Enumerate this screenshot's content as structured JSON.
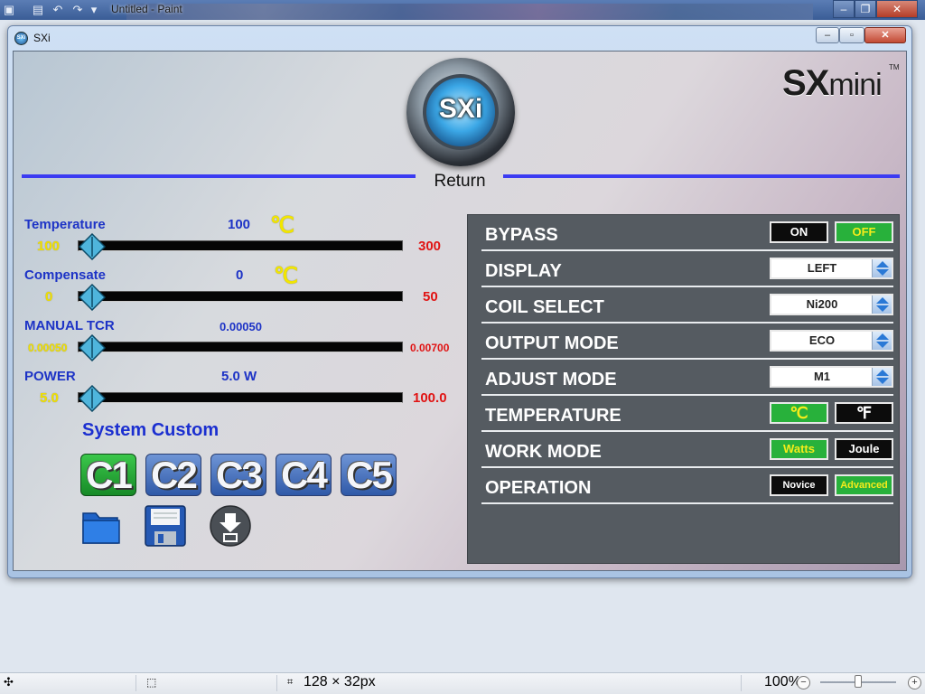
{
  "paint": {
    "title": "Untitled - Paint",
    "status": {
      "selection_size": "128 × 32px",
      "zoom": "100%"
    }
  },
  "window": {
    "title": "SXi"
  },
  "header": {
    "logo_text": "SXi",
    "brand_main": "SX",
    "brand_sub": "mini",
    "brand_tm": "TM",
    "return_label": "Return"
  },
  "sliders": [
    {
      "label": "Temperature",
      "value": "100",
      "unit": "℃",
      "min": "100",
      "max": "300"
    },
    {
      "label": "Compensate",
      "value": "0",
      "unit": "℃",
      "min": "0",
      "max": "50"
    },
    {
      "label": "MANUAL TCR",
      "value": "0.00050",
      "unit": "",
      "min": "0.00050",
      "max": "0.00700"
    },
    {
      "label": "POWER",
      "value": "5.0 W",
      "unit": "",
      "min": "5.0",
      "max": "100.0"
    }
  ],
  "system_custom": {
    "title": "System Custom",
    "buttons": [
      "C1",
      "C2",
      "C3",
      "C4",
      "C5"
    ],
    "active": "C1"
  },
  "settings": {
    "bypass": {
      "label": "BYPASS",
      "options": [
        "ON",
        "OFF"
      ],
      "selected": "OFF"
    },
    "display": {
      "label": "DISPLAY",
      "value": "LEFT"
    },
    "coil_select": {
      "label": "COIL SELECT",
      "value": "Ni200"
    },
    "output_mode": {
      "label": "OUTPUT MODE",
      "value": "ECO"
    },
    "adjust_mode": {
      "label": "ADJUST MODE",
      "value": "M1"
    },
    "temperature": {
      "label": "TEMPERATURE",
      "options": [
        "℃",
        "℉"
      ],
      "selected": "℃"
    },
    "work_mode": {
      "label": "WORK MODE",
      "options": [
        "Watts",
        "Joule"
      ],
      "selected": "Watts"
    },
    "operation": {
      "label": "OPERATION",
      "options": [
        "Novice",
        "Advanced"
      ],
      "selected": "Advanced"
    }
  },
  "colors": {
    "accent_blue": "#3b3bf2",
    "label_blue": "#1d33c6",
    "active_green": "#28b13b",
    "value_yellow": "#f0e000",
    "max_red": "#e01414"
  },
  "icons": [
    "folder-icon",
    "save-icon",
    "download-icon"
  ]
}
